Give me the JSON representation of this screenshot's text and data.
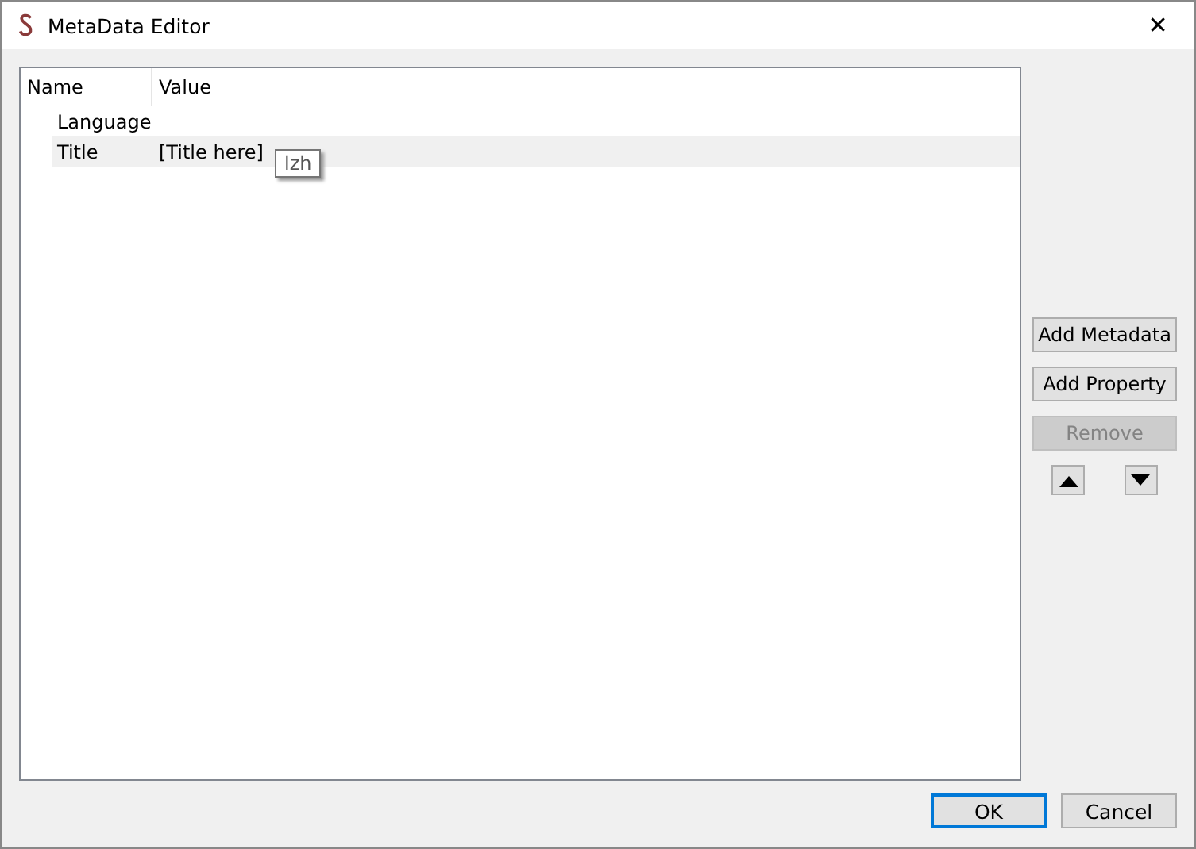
{
  "window": {
    "title": "MetaData Editor",
    "close": "✕"
  },
  "table": {
    "columns": [
      "Name",
      "Value"
    ],
    "rows": [
      {
        "name": "Language",
        "value": "",
        "selected": false
      },
      {
        "name": "Title",
        "value": "[Title here]",
        "selected": true
      }
    ]
  },
  "tooltip": "lzh",
  "side_buttons": [
    {
      "label": "Add Metadata",
      "disabled": false
    },
    {
      "label": "Add Property",
      "disabled": false
    },
    {
      "label": "Remove",
      "disabled": true
    }
  ],
  "arrow_buttons": [
    {
      "kind": "up"
    },
    {
      "kind": "down"
    }
  ],
  "buttons": [
    {
      "label": "OK",
      "default": true
    },
    {
      "label": "Cancel",
      "default": false
    }
  ]
}
